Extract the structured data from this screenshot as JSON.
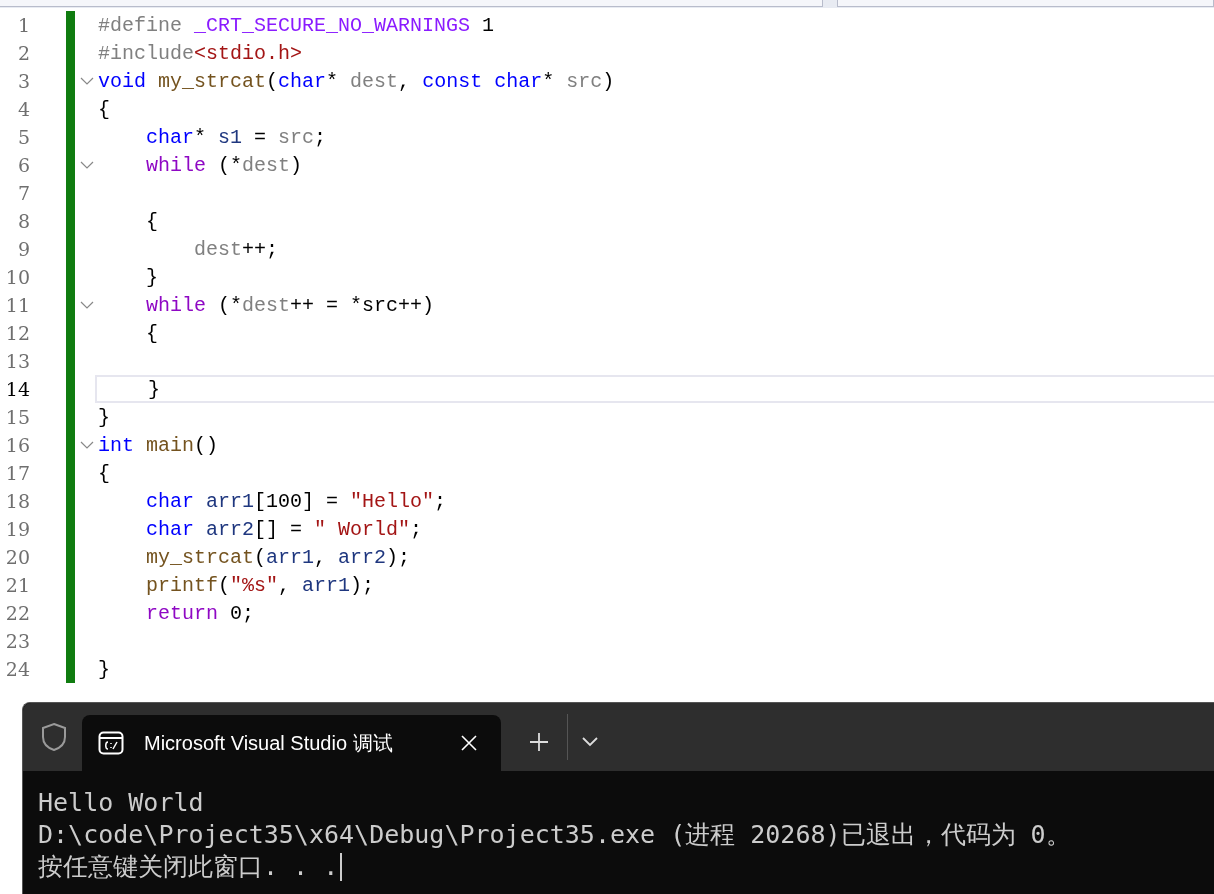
{
  "editor": {
    "lines": [
      {
        "number": "1",
        "foldable": false,
        "current": false,
        "tokens": [
          {
            "kind": "pre",
            "t": "#define "
          },
          {
            "kind": "macro",
            "t": "_CRT_SECURE_NO_WARNINGS"
          },
          {
            "kind": "plain",
            "t": " 1"
          }
        ]
      },
      {
        "number": "2",
        "foldable": false,
        "current": false,
        "tokens": [
          {
            "kind": "pre",
            "t": "#include"
          },
          {
            "kind": "str",
            "t": "<stdio.h>"
          }
        ]
      },
      {
        "number": "3",
        "foldable": true,
        "current": false,
        "tokens": [
          {
            "kind": "kw",
            "t": "void"
          },
          {
            "kind": "fn",
            "t": " my_strcat"
          },
          {
            "kind": "plain",
            "t": "("
          },
          {
            "kind": "kw",
            "t": "char"
          },
          {
            "kind": "plain",
            "t": "* "
          },
          {
            "kind": "param",
            "t": "dest"
          },
          {
            "kind": "plain",
            "t": ", "
          },
          {
            "kind": "kw",
            "t": "const char"
          },
          {
            "kind": "plain",
            "t": "* "
          },
          {
            "kind": "param",
            "t": "src"
          },
          {
            "kind": "plain",
            "t": ")"
          }
        ]
      },
      {
        "number": "4",
        "foldable": false,
        "current": false,
        "tokens": [
          {
            "kind": "plain",
            "t": "{"
          }
        ]
      },
      {
        "number": "5",
        "foldable": false,
        "current": false,
        "tokens": [
          {
            "kind": "kw",
            "t": "    char"
          },
          {
            "kind": "plain",
            "t": "* "
          },
          {
            "kind": "var",
            "t": "s1"
          },
          {
            "kind": "plain",
            "t": " = "
          },
          {
            "kind": "param",
            "t": "src"
          },
          {
            "kind": "plain",
            "t": ";"
          }
        ]
      },
      {
        "number": "6",
        "foldable": true,
        "current": false,
        "tokens": [
          {
            "kind": "ctl",
            "t": "    while"
          },
          {
            "kind": "plain",
            "t": " (*"
          },
          {
            "kind": "param",
            "t": "dest"
          },
          {
            "kind": "plain",
            "t": ")"
          }
        ]
      },
      {
        "number": "7",
        "foldable": false,
        "current": false
      },
      {
        "number": "8",
        "foldable": false,
        "current": false,
        "tokens": [
          {
            "kind": "plain",
            "t": "    {"
          }
        ]
      },
      {
        "number": "9",
        "foldable": false,
        "current": false,
        "tokens": [
          {
            "kind": "param",
            "t": "        dest"
          },
          {
            "kind": "plain",
            "t": "++;"
          }
        ]
      },
      {
        "number": "10",
        "foldable": false,
        "current": false,
        "tokens": [
          {
            "kind": "plain",
            "t": "    }"
          }
        ]
      },
      {
        "number": "11",
        "foldable": true,
        "current": false,
        "tokens": [
          {
            "kind": "ctl",
            "t": "    while"
          },
          {
            "kind": "plain",
            "t": " (*"
          },
          {
            "kind": "param",
            "t": "dest"
          },
          {
            "kind": "plain",
            "t": "++ = *src++)"
          }
        ]
      },
      {
        "number": "12",
        "foldable": false,
        "current": false,
        "tokens": [
          {
            "kind": "plain",
            "t": "    {"
          }
        ]
      },
      {
        "number": "13",
        "foldable": false,
        "current": false
      },
      {
        "number": "14",
        "foldable": false,
        "current": true,
        "tokens": [
          {
            "kind": "plain",
            "t": "    }"
          }
        ]
      },
      {
        "number": "15",
        "foldable": false,
        "current": false,
        "tokens": [
          {
            "kind": "plain",
            "t": "}"
          }
        ]
      },
      {
        "number": "16",
        "foldable": true,
        "current": false,
        "tokens": [
          {
            "kind": "kw",
            "t": "int"
          },
          {
            "kind": "fn",
            "t": " main"
          },
          {
            "kind": "plain",
            "t": "()"
          }
        ]
      },
      {
        "number": "17",
        "foldable": false,
        "current": false,
        "tokens": [
          {
            "kind": "plain",
            "t": "{"
          }
        ]
      },
      {
        "number": "18",
        "foldable": false,
        "current": false,
        "tokens": [
          {
            "kind": "kw",
            "t": "    char"
          },
          {
            "kind": "var",
            "t": " arr1"
          },
          {
            "kind": "plain",
            "t": "[100] = "
          },
          {
            "kind": "str",
            "t": "\"Hello\""
          },
          {
            "kind": "plain",
            "t": ";"
          }
        ]
      },
      {
        "number": "19",
        "foldable": false,
        "current": false,
        "tokens": [
          {
            "kind": "kw",
            "t": "    char"
          },
          {
            "kind": "var",
            "t": " arr2"
          },
          {
            "kind": "plain",
            "t": "[] = "
          },
          {
            "kind": "str",
            "t": "\" World\""
          },
          {
            "kind": "plain",
            "t": ";"
          }
        ]
      },
      {
        "number": "20",
        "foldable": false,
        "current": false,
        "tokens": [
          {
            "kind": "fn",
            "t": "    my_strcat"
          },
          {
            "kind": "plain",
            "t": "("
          },
          {
            "kind": "var",
            "t": "arr1"
          },
          {
            "kind": "plain",
            "t": ", "
          },
          {
            "kind": "var",
            "t": "arr2"
          },
          {
            "kind": "plain",
            "t": ");"
          }
        ]
      },
      {
        "number": "21",
        "foldable": false,
        "current": false,
        "tokens": [
          {
            "kind": "fn",
            "t": "    printf"
          },
          {
            "kind": "plain",
            "t": "("
          },
          {
            "kind": "str",
            "t": "\"%s\""
          },
          {
            "kind": "plain",
            "t": ", "
          },
          {
            "kind": "var",
            "t": "arr1"
          },
          {
            "kind": "plain",
            "t": ");"
          }
        ]
      },
      {
        "number": "22",
        "foldable": false,
        "current": false,
        "tokens": [
          {
            "kind": "ctl",
            "t": "    return"
          },
          {
            "kind": "plain",
            "t": " 0;"
          }
        ]
      },
      {
        "number": "23",
        "foldable": false,
        "current": false
      },
      {
        "number": "24",
        "foldable": false,
        "current": false,
        "tokens": [
          {
            "kind": "plain",
            "t": "}"
          }
        ]
      }
    ]
  },
  "terminal": {
    "tab": {
      "title": "Microsoft Visual Studio 调试",
      "selected": true
    },
    "lines": [
      "Hello World",
      "D:\\code\\Project35\\x64\\Debug\\Project35.exe (进程 20268)已退出，代码为 0。",
      "按任意键关闭此窗口. . ."
    ]
  }
}
